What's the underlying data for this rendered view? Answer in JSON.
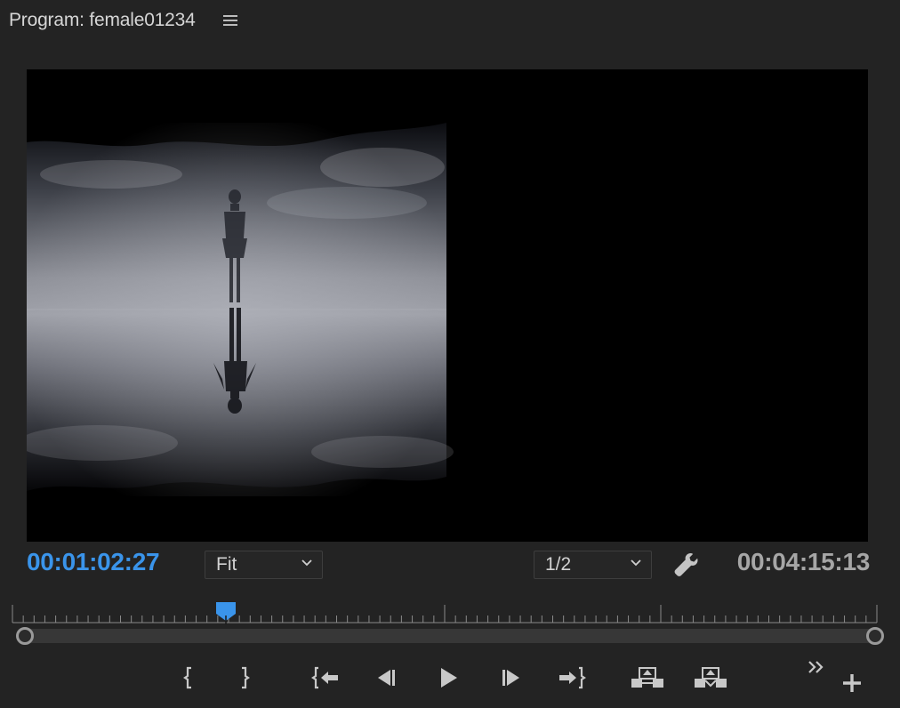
{
  "panel": {
    "title": "Program: female01234",
    "menu_icon": "hamburger-menu-icon"
  },
  "viewer": {
    "content": "video-frame"
  },
  "timecode": {
    "current": "00:01:02:27",
    "duration": "00:04:15:13",
    "current_color": "#3a94ea"
  },
  "controls": {
    "zoom": {
      "value": "Fit"
    },
    "resolution": {
      "value": "1/2"
    },
    "settings_icon": "wrench-icon"
  },
  "timeline": {
    "playhead_fraction": 0.247,
    "playhead_color": "#3a94ea"
  },
  "transport": {
    "buttons": [
      "mark-in-icon",
      "mark-out-icon",
      "go-to-in-icon",
      "step-back-icon",
      "play-icon",
      "step-forward-icon",
      "go-to-out-icon",
      "lift-icon",
      "extract-icon",
      "more-controls-icon",
      "add-button-icon"
    ]
  }
}
